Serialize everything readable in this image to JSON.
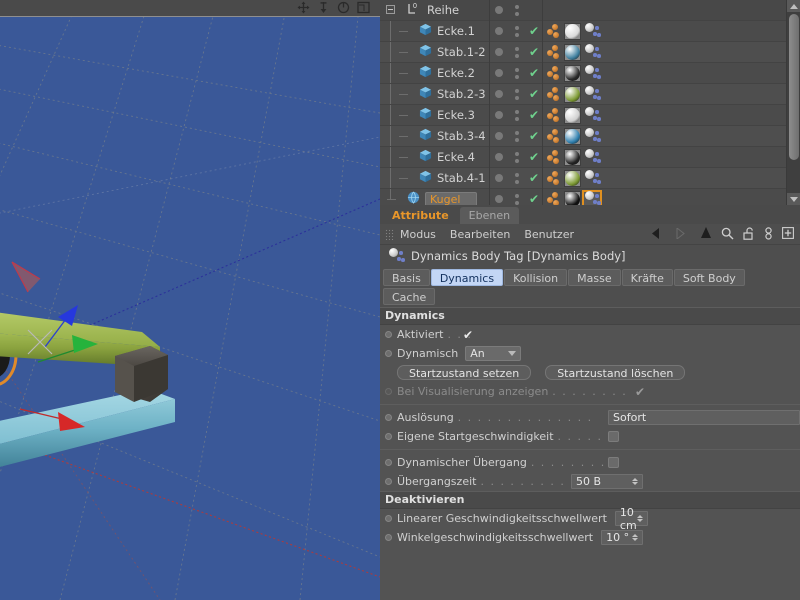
{
  "viewport": {
    "nav_icons": [
      "move-icon",
      "scale-icon",
      "rotate-icon",
      "maximize-icon"
    ],
    "background_color": "#3a5898",
    "objects": [
      "green-bar",
      "cyan-bar",
      "dark-cube",
      "orange-ring"
    ]
  },
  "object_manager": {
    "root": {
      "label": "Reihe",
      "icon": "array-null-icon"
    },
    "items": [
      {
        "label": "Ecke.1",
        "icon": "cube-icon",
        "material": "#d9d9d9",
        "check": "✔"
      },
      {
        "label": "Stab.1-2",
        "icon": "cube-icon",
        "material": "#3f7f9e",
        "check": "✔"
      },
      {
        "label": "Ecke.2",
        "icon": "cube-icon",
        "material": "#2a2a2a",
        "check": "✔"
      },
      {
        "label": "Stab.2-3",
        "icon": "cube-icon",
        "material": "#7d9a33",
        "check": "✔"
      },
      {
        "label": "Ecke.3",
        "icon": "cube-icon",
        "material": "#cfcfcf",
        "check": "✔"
      },
      {
        "label": "Stab.3-4",
        "icon": "cube-icon",
        "material": "#2f7fae",
        "check": "✔"
      },
      {
        "label": "Ecke.4",
        "icon": "cube-icon",
        "material": "#242424",
        "check": "✔"
      },
      {
        "label": "Stab.4-1",
        "icon": "cube-icon",
        "material": "#7d9a33",
        "check": "✔"
      },
      {
        "label": "Kugel",
        "icon": "sphere-icon",
        "material": "#111111",
        "check": "✔",
        "selected": true
      }
    ],
    "selection_color": "#e8962a"
  },
  "attribute_manager": {
    "tabs": [
      {
        "label": "Attribute",
        "active": true
      },
      {
        "label": "Ebenen",
        "active": false
      }
    ],
    "menus": [
      "Modus",
      "Bearbeiten",
      "Benutzer"
    ],
    "tool_icons": [
      "back-arrow-icon",
      "forward-arrow-icon",
      "up-arrow-icon",
      "search-icon",
      "lock-open-icon",
      "link-icon",
      "add-box-icon"
    ],
    "object_title": "Dynamics Body Tag [Dynamics Body]",
    "object_icon": "dynamics-body-tag-icon",
    "property_tabs": [
      {
        "label": "Basis",
        "active": false
      },
      {
        "label": "Dynamics",
        "active": true
      },
      {
        "label": "Kollision",
        "active": false
      },
      {
        "label": "Masse",
        "active": false
      },
      {
        "label": "Kräfte",
        "active": false
      },
      {
        "label": "Soft Body",
        "active": false
      },
      {
        "label": "Cache",
        "active": false
      }
    ],
    "sections": {
      "dynamics": {
        "title": "Dynamics",
        "aktiviert": {
          "label": "Aktiviert",
          "value": "✔"
        },
        "dynamisch": {
          "label": "Dynamisch",
          "value": "An"
        },
        "buttons": {
          "set": "Startzustand setzen",
          "clear": "Startzustand löschen"
        },
        "visualisierung": {
          "label": "Bei Visualisierung anzeigen",
          "value": "✔"
        },
        "ausloesung": {
          "label": "Auslösung",
          "value": "Sofort"
        },
        "startgeschwindigkeit": {
          "label": "Eigene Startgeschwindigkeit",
          "value": ""
        },
        "uebergang": {
          "label": "Dynamischer Übergang",
          "value": ""
        },
        "uebergangszeit": {
          "label": "Übergangszeit",
          "value": "50 B"
        }
      },
      "deaktivieren": {
        "title": "Deaktivieren",
        "linear": {
          "label": "Linearer Geschwindigkeitsschwellwert",
          "value": "10 cm"
        },
        "winkel": {
          "label": "Winkelgeschwindigkeitsschwellwert",
          "value": "10 °"
        }
      }
    }
  }
}
